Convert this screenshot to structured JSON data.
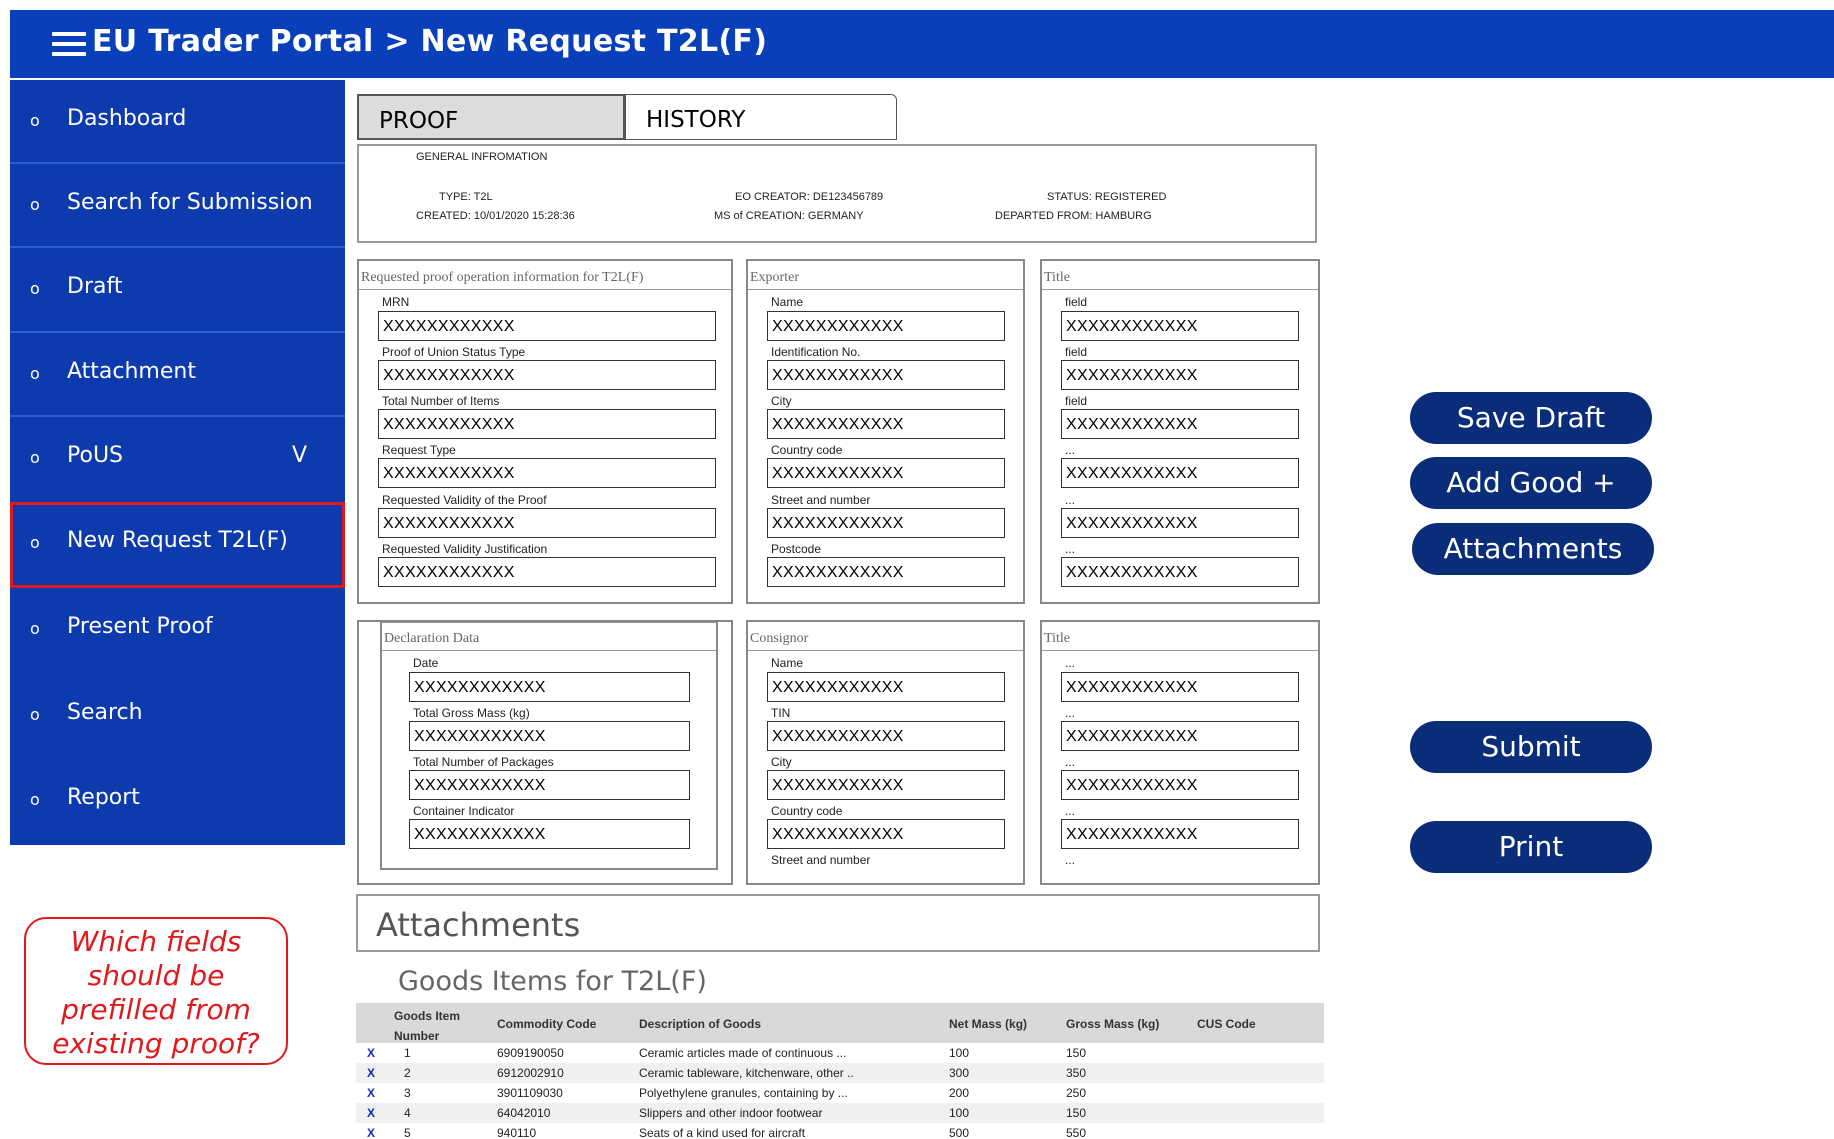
{
  "header": {
    "title": "EU Trader Portal > New Request T2L(F)"
  },
  "sidebar": {
    "items": [
      {
        "label": "Dashboard"
      },
      {
        "label": "Search for Submission"
      },
      {
        "label": "Draft"
      },
      {
        "label": "Attachment"
      },
      {
        "label": "PoUS",
        "caret": "V"
      },
      {
        "label": "New Request T2L(F)"
      },
      {
        "label": "Present Proof"
      },
      {
        "label": "Search"
      },
      {
        "label": "Report"
      }
    ],
    "bullet": "o"
  },
  "tabs": {
    "proof": "PROOF",
    "history": "HISTORY"
  },
  "general_info": {
    "heading": "GENERAL INFROMATION",
    "type": "TYPE: T2L",
    "created": "CREATED: 10/01/2020 15:28:36",
    "eo_creator": "EO CREATOR: DE123456789",
    "ms_creation": "MS of CREATION: GERMANY",
    "status": "STATUS: REGISTERED",
    "departed": "DEPARTED FROM: HAMBURG"
  },
  "panels": {
    "proof_op": {
      "title": "Requested proof operation information for T2L(F)",
      "fields": [
        {
          "label": "MRN",
          "value": "XXXXXXXXXXXX"
        },
        {
          "label": "Proof of Union Status Type",
          "value": "XXXXXXXXXXXX"
        },
        {
          "label": "Total Number of Items",
          "value": "XXXXXXXXXXXX"
        },
        {
          "label": "Request Type",
          "value": "XXXXXXXXXXXX"
        },
        {
          "label": "Requested Validity of the Proof",
          "value": "XXXXXXXXXXXX"
        },
        {
          "label": "Requested Validity Justification",
          "value": "XXXXXXXXXXXX"
        }
      ]
    },
    "exporter": {
      "title": "Exporter",
      "fields": [
        {
          "label": "Name",
          "value": "XXXXXXXXXXXX"
        },
        {
          "label": "Identification No.",
          "value": "XXXXXXXXXXXX"
        },
        {
          "label": "City",
          "value": "XXXXXXXXXXXX"
        },
        {
          "label": "Country code",
          "value": "XXXXXXXXXXXX"
        },
        {
          "label": "Street and number",
          "value": "XXXXXXXXXXXX"
        },
        {
          "label": "Postcode",
          "value": "XXXXXXXXXXXX"
        }
      ]
    },
    "title_top": {
      "title": "Title",
      "fields": [
        {
          "label": "field",
          "value": "XXXXXXXXXXXX"
        },
        {
          "label": "field",
          "value": "XXXXXXXXXXXX"
        },
        {
          "label": "field",
          "value": "XXXXXXXXXXXX"
        },
        {
          "label": "...",
          "value": "XXXXXXXXXXXX"
        },
        {
          "label": "...",
          "value": "XXXXXXXXXXXX"
        },
        {
          "label": "...",
          "value": "XXXXXXXXXXXX"
        }
      ]
    },
    "declaration": {
      "title": "Declaration Data",
      "fields": [
        {
          "label": "Date",
          "value": "XXXXXXXXXXXX"
        },
        {
          "label": "Total Gross Mass (kg)",
          "value": "XXXXXXXXXXXX"
        },
        {
          "label": "Total Number of Packages",
          "value": "XXXXXXXXXXXX"
        },
        {
          "label": "Container Indicator",
          "value": "XXXXXXXXXXXX"
        }
      ]
    },
    "consignor": {
      "title": "Consignor",
      "fields": [
        {
          "label": "Name",
          "value": "XXXXXXXXXXXX"
        },
        {
          "label": "TIN",
          "value": "XXXXXXXXXXXX"
        },
        {
          "label": "City",
          "value": "XXXXXXXXXXXX"
        },
        {
          "label": "Country code",
          "value": "XXXXXXXXXXXX"
        }
      ],
      "trailing_label": "Street and number"
    },
    "title_bottom": {
      "title": "Title",
      "fields": [
        {
          "label": "...",
          "value": "XXXXXXXXXXXX"
        },
        {
          "label": "...",
          "value": "XXXXXXXXXXXX"
        },
        {
          "label": "...",
          "value": "XXXXXXXXXXXX"
        },
        {
          "label": "...",
          "value": "XXXXXXXXXXXX"
        }
      ],
      "trailing_label": "..."
    }
  },
  "actions": {
    "save_draft": "Save Draft",
    "add_good": "Add Good +",
    "attachments": "Attachments",
    "submit": "Submit",
    "print": "Print"
  },
  "attachments_section": {
    "label": "Attachments"
  },
  "goods": {
    "heading": "Goods Items  for T2L(F)",
    "columns": {
      "item_number": "Goods Item Number",
      "commodity": "Commodity Code",
      "description": "Description of Goods",
      "net_mass": "Net Mass (kg)",
      "gross_mass": "Gross Mass (kg)",
      "cus": "CUS Code"
    },
    "delete_mark": "X",
    "rows": [
      {
        "num": "1",
        "code": "6909190050",
        "desc": "Ceramic articles made of continuous ...",
        "net": "100",
        "gross": "150"
      },
      {
        "num": "2",
        "code": "6912002910",
        "desc": "Ceramic tableware, kitchenware, other ..",
        "net": "300",
        "gross": "350"
      },
      {
        "num": "3",
        "code": "3901109030",
        "desc": "Polyethylene granules, containing by ...",
        "net": "200",
        "gross": "250"
      },
      {
        "num": "4",
        "code": "64042010",
        "desc": "Slippers and other indoor footwear",
        "net": "100",
        "gross": "150"
      },
      {
        "num": "5",
        "code": "940110",
        "desc": "Seats of a kind used for aircraft",
        "net": "500",
        "gross": "550"
      }
    ]
  },
  "note": {
    "text_lines": [
      "Which fields",
      "should be",
      "prefilled from",
      "existing proof?"
    ]
  },
  "colors": {
    "header_blue": "#0a3fba",
    "sidebar_blue": "#0d3aac",
    "button_navy": "#0a2d7a",
    "alert_red": "#e0191d"
  }
}
